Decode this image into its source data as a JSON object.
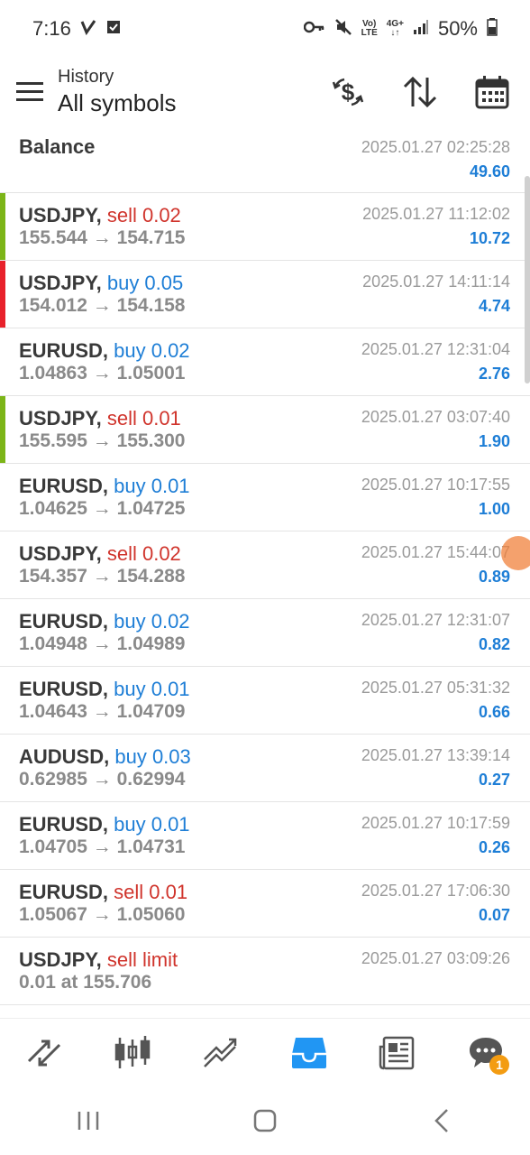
{
  "status_bar": {
    "time": "7:16",
    "battery": "50%",
    "net_label_top": "Vo)",
    "net_label_bottom": "LTE",
    "gen_label": "4G+"
  },
  "header": {
    "subtitle": "History",
    "title": "All symbols"
  },
  "balance": {
    "label": "Balance",
    "date": "2025.01.27 02:25:28",
    "amount": "49.60"
  },
  "rows": [
    {
      "symbol": "USDJPY,",
      "type": "sell 0.02",
      "prices": "155.544 → 154.715",
      "date": "2025.01.27 11:12:02",
      "profit": "10.72",
      "side": "sell",
      "bar": "#7cb518"
    },
    {
      "symbol": "USDJPY,",
      "type": "buy 0.05",
      "prices": "154.012 → 154.158",
      "date": "2025.01.27 14:11:14",
      "profit": "4.74",
      "side": "buy",
      "bar": "#e8212b"
    },
    {
      "symbol": "EURUSD,",
      "type": "buy 0.02",
      "prices": "1.04863 → 1.05001",
      "date": "2025.01.27 12:31:04",
      "profit": "2.76",
      "side": "buy",
      "bar": ""
    },
    {
      "symbol": "USDJPY,",
      "type": "sell 0.01",
      "prices": "155.595 → 155.300",
      "date": "2025.01.27 03:07:40",
      "profit": "1.90",
      "side": "sell",
      "bar": "#7cb518"
    },
    {
      "symbol": "EURUSD,",
      "type": "buy 0.01",
      "prices": "1.04625 → 1.04725",
      "date": "2025.01.27 10:17:55",
      "profit": "1.00",
      "side": "buy",
      "bar": ""
    },
    {
      "symbol": "USDJPY,",
      "type": "sell 0.02",
      "prices": "154.357 → 154.288",
      "date": "2025.01.27 15:44:07",
      "profit": "0.89",
      "side": "sell",
      "bar": ""
    },
    {
      "symbol": "EURUSD,",
      "type": "buy 0.02",
      "prices": "1.04948 → 1.04989",
      "date": "2025.01.27 12:31:07",
      "profit": "0.82",
      "side": "buy",
      "bar": ""
    },
    {
      "symbol": "EURUSD,",
      "type": "buy 0.01",
      "prices": "1.04643 → 1.04709",
      "date": "2025.01.27 05:31:32",
      "profit": "0.66",
      "side": "buy",
      "bar": ""
    },
    {
      "symbol": "AUDUSD,",
      "type": "buy 0.03",
      "prices": "0.62985 → 0.62994",
      "date": "2025.01.27 13:39:14",
      "profit": "0.27",
      "side": "buy",
      "bar": ""
    },
    {
      "symbol": "EURUSD,",
      "type": "buy 0.01",
      "prices": "1.04705 → 1.04731",
      "date": "2025.01.27 10:17:59",
      "profit": "0.26",
      "side": "buy",
      "bar": ""
    },
    {
      "symbol": "EURUSD,",
      "type": "sell 0.01",
      "prices": "1.05067 → 1.05060",
      "date": "2025.01.27 17:06:30",
      "profit": "0.07",
      "side": "sell",
      "bar": ""
    },
    {
      "symbol": "USDJPY,",
      "type": "sell limit",
      "prices": "0.01 at 155.706",
      "date": "2025.01.27 03:09:26",
      "profit": "",
      "side": "sell",
      "bar": ""
    }
  ],
  "bottom_nav": {
    "chat_badge": "1",
    "items": [
      "quotes-icon",
      "chart-icon",
      "trade-icon",
      "history-icon",
      "news-icon",
      "chat-icon"
    ]
  },
  "colors": {
    "buy": "#1e7ed6",
    "sell": "#d0342c",
    "accent": "#2196f3"
  }
}
